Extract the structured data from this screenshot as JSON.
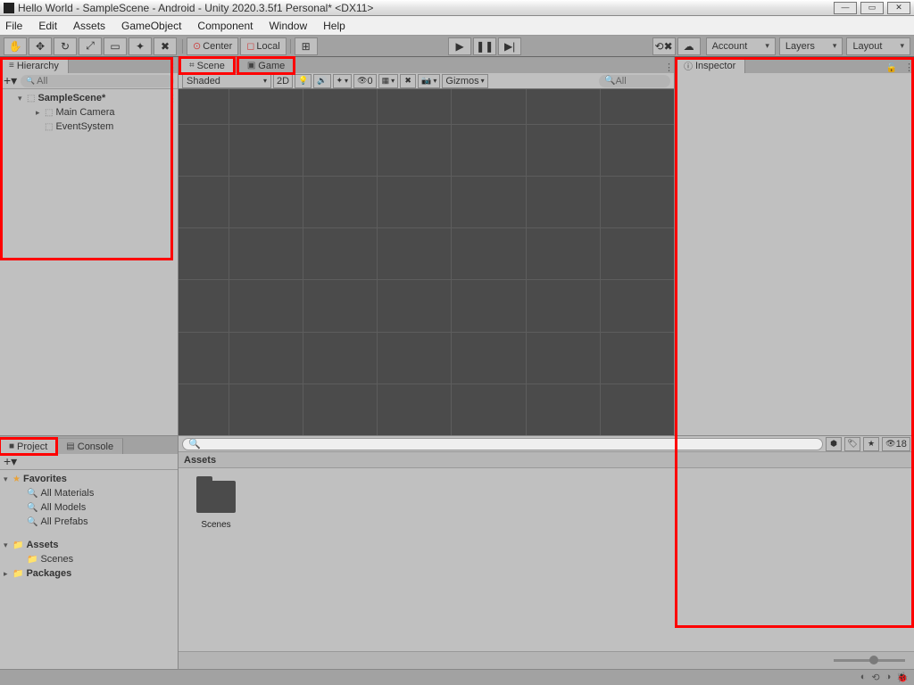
{
  "title": "Hello World - SampleScene - Android - Unity 2020.3.5f1 Personal* <DX11>",
  "menu": [
    "File",
    "Edit",
    "Assets",
    "GameObject",
    "Component",
    "Window",
    "Help"
  ],
  "toolbar": {
    "center": "Center",
    "local": "Local",
    "account": "Account",
    "layers": "Layers",
    "layout": "Layout"
  },
  "hierarchy": {
    "tab": "Hierarchy",
    "search": "All",
    "scene": "SampleScene*",
    "items": [
      "Main Camera",
      "EventSystem"
    ]
  },
  "sceneTabs": {
    "scene": "Scene",
    "game": "Game"
  },
  "sceneToolbar": {
    "dropdown": "Shaded",
    "b2d": "2D",
    "gizmos": "Gizmos",
    "search": "All",
    "zero": "0"
  },
  "inspector": {
    "tab": "Inspector"
  },
  "projectTabs": {
    "project": "Project",
    "console": "Console"
  },
  "project": {
    "hidden": "18"
  },
  "favorites": {
    "label": "Favorites",
    "items": [
      "All Materials",
      "All Models",
      "All Prefabs"
    ]
  },
  "assets": {
    "label": "Assets",
    "children": [
      "Scenes"
    ]
  },
  "packages": {
    "label": "Packages"
  },
  "breadcrumb": "Assets",
  "assetItems": {
    "scenes": "Scenes"
  }
}
